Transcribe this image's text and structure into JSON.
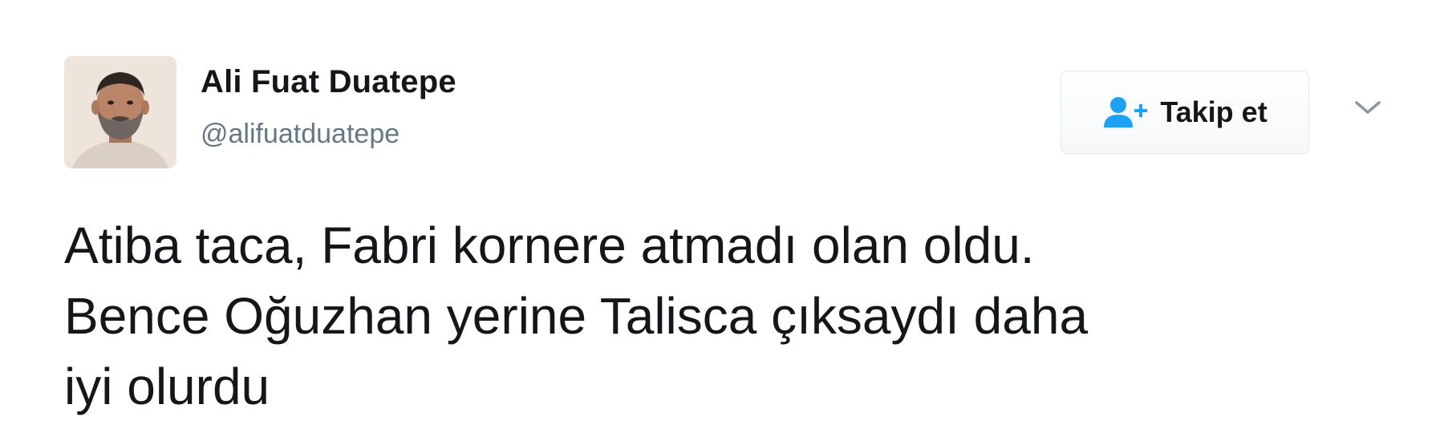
{
  "user": {
    "display_name": "Ali Fuat Duatepe",
    "handle": "@alifuatduatepe",
    "avatar_icon": "profile-photo"
  },
  "actions": {
    "follow_label": "Takip et",
    "follow_icon": "add-user-icon",
    "more_icon": "chevron-down-icon"
  },
  "tweet": {
    "lines": [
      "Atiba taca, Fabri kornere atmadı olan oldu.",
      "Bence Oğuzhan yerine Talisca çıksaydı daha",
      "iyi olurdu"
    ]
  },
  "colors": {
    "text": "#14171a",
    "secondary": "#657786",
    "accent": "#1da1f2",
    "border": "#e1e8ed"
  }
}
